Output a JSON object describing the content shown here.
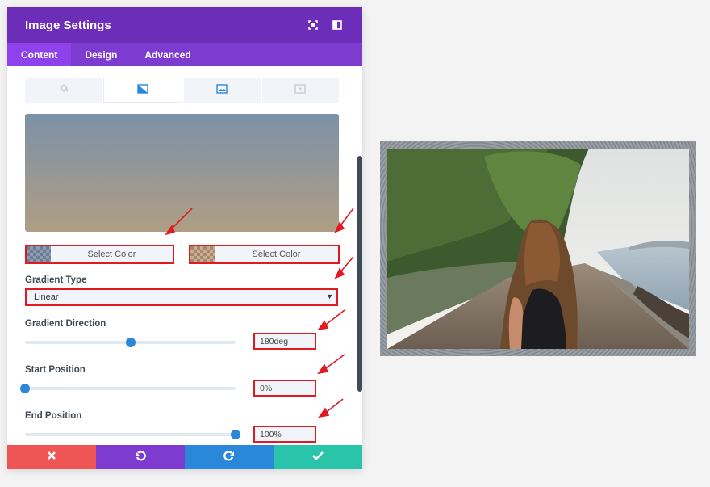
{
  "header": {
    "title": "Image Settings"
  },
  "tabs": [
    {
      "label": "Content",
      "active": true
    },
    {
      "label": "Design",
      "active": false
    },
    {
      "label": "Advanced",
      "active": false
    }
  ],
  "background_tabs": [
    {
      "icon": "paint-bucket-icon",
      "active": false
    },
    {
      "icon": "gradient-icon",
      "active": true
    },
    {
      "icon": "image-icon",
      "active": false
    },
    {
      "icon": "video-icon",
      "active": false
    }
  ],
  "gradient": {
    "start_color": "#7b91a8",
    "end_color": "#b09e83",
    "color_pickers": [
      {
        "label": "Select Color"
      },
      {
        "label": "Select Color"
      }
    ],
    "type_label": "Gradient Type",
    "type_value": "Linear",
    "direction_label": "Gradient Direction",
    "direction_value": "180deg",
    "direction_fraction": 0.5,
    "start_label": "Start Position",
    "start_value": "0%",
    "start_fraction": 0,
    "end_label": "End Position",
    "end_value": "100%",
    "end_fraction": 1
  },
  "colors": {
    "header": "#6c2eb9",
    "accent": "#2b87da",
    "discard": "#ef5555",
    "undo": "#7e3bd0",
    "redo": "#2b87da",
    "save": "#29c4a9",
    "highlight": "#e01a22"
  },
  "footer": {
    "icons": [
      "close-icon",
      "undo-icon",
      "redo-icon",
      "check-icon"
    ]
  }
}
